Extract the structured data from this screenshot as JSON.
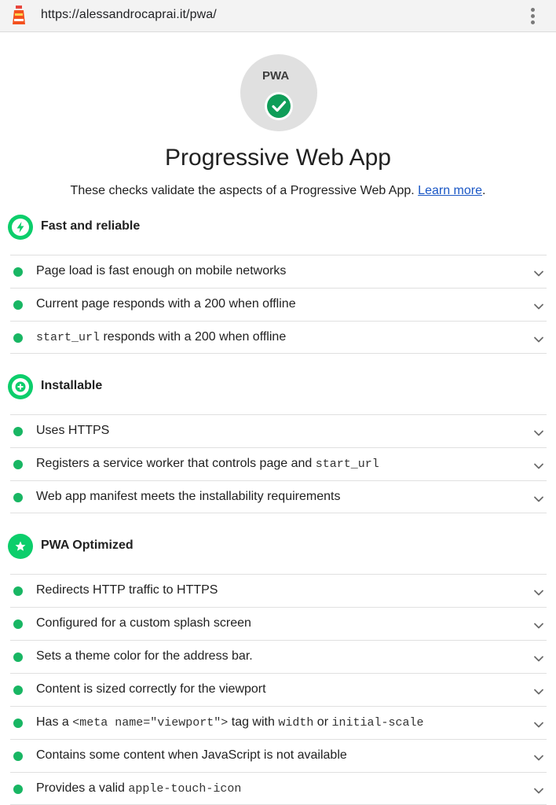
{
  "browser": {
    "url": "https://alessandrocaprai.it/pwa/",
    "lighthouse_icon": "lighthouse-icon",
    "menu_icon": "more-vert-icon"
  },
  "header": {
    "logo_text": "PWA",
    "status_icon": "check-circle-icon",
    "title": "Progressive Web App",
    "description": "These checks validate the aspects of a Progressive Web App.",
    "learn_more": "Learn more",
    "learn_more_suffix": "."
  },
  "colors": {
    "pass_green": "#0cce6b",
    "dot_green": "#18b663",
    "link_blue": "#1a57c5",
    "gauge_gray": "#e0e0e0"
  },
  "groups": [
    {
      "title": "Fast and reliable",
      "icon": "bolt-icon",
      "audits": [
        {
          "parts": [
            {
              "t": "Page load is fast enough on mobile networks"
            }
          ]
        },
        {
          "parts": [
            {
              "t": "Current page responds with a 200 when offline"
            }
          ]
        },
        {
          "parts": [
            {
              "t": "start_url",
              "code": true
            },
            {
              "t": " responds with a 200 when offline"
            }
          ]
        }
      ]
    },
    {
      "title": "Installable",
      "icon": "plus-icon",
      "audits": [
        {
          "parts": [
            {
              "t": "Uses HTTPS"
            }
          ]
        },
        {
          "parts": [
            {
              "t": "Registers a service worker that controls page and "
            },
            {
              "t": "start_url",
              "code": true
            }
          ]
        },
        {
          "parts": [
            {
              "t": "Web app manifest meets the installability requirements"
            }
          ]
        }
      ]
    },
    {
      "title": "PWA Optimized",
      "icon": "star-icon",
      "audits": [
        {
          "parts": [
            {
              "t": "Redirects HTTP traffic to HTTPS"
            }
          ]
        },
        {
          "parts": [
            {
              "t": "Configured for a custom splash screen"
            }
          ]
        },
        {
          "parts": [
            {
              "t": "Sets a theme color for the address bar."
            }
          ]
        },
        {
          "parts": [
            {
              "t": "Content is sized correctly for the viewport"
            }
          ]
        },
        {
          "parts": [
            {
              "t": "Has a "
            },
            {
              "t": "<meta name=\"viewport\">",
              "code": true
            },
            {
              "t": " tag with "
            },
            {
              "t": "width",
              "code": true
            },
            {
              "t": " or "
            },
            {
              "t": "initial-scale",
              "code": true
            }
          ]
        },
        {
          "parts": [
            {
              "t": "Contains some content when JavaScript is not available"
            }
          ]
        },
        {
          "parts": [
            {
              "t": "Provides a valid "
            },
            {
              "t": "apple-touch-icon",
              "code": true
            }
          ]
        }
      ]
    }
  ]
}
